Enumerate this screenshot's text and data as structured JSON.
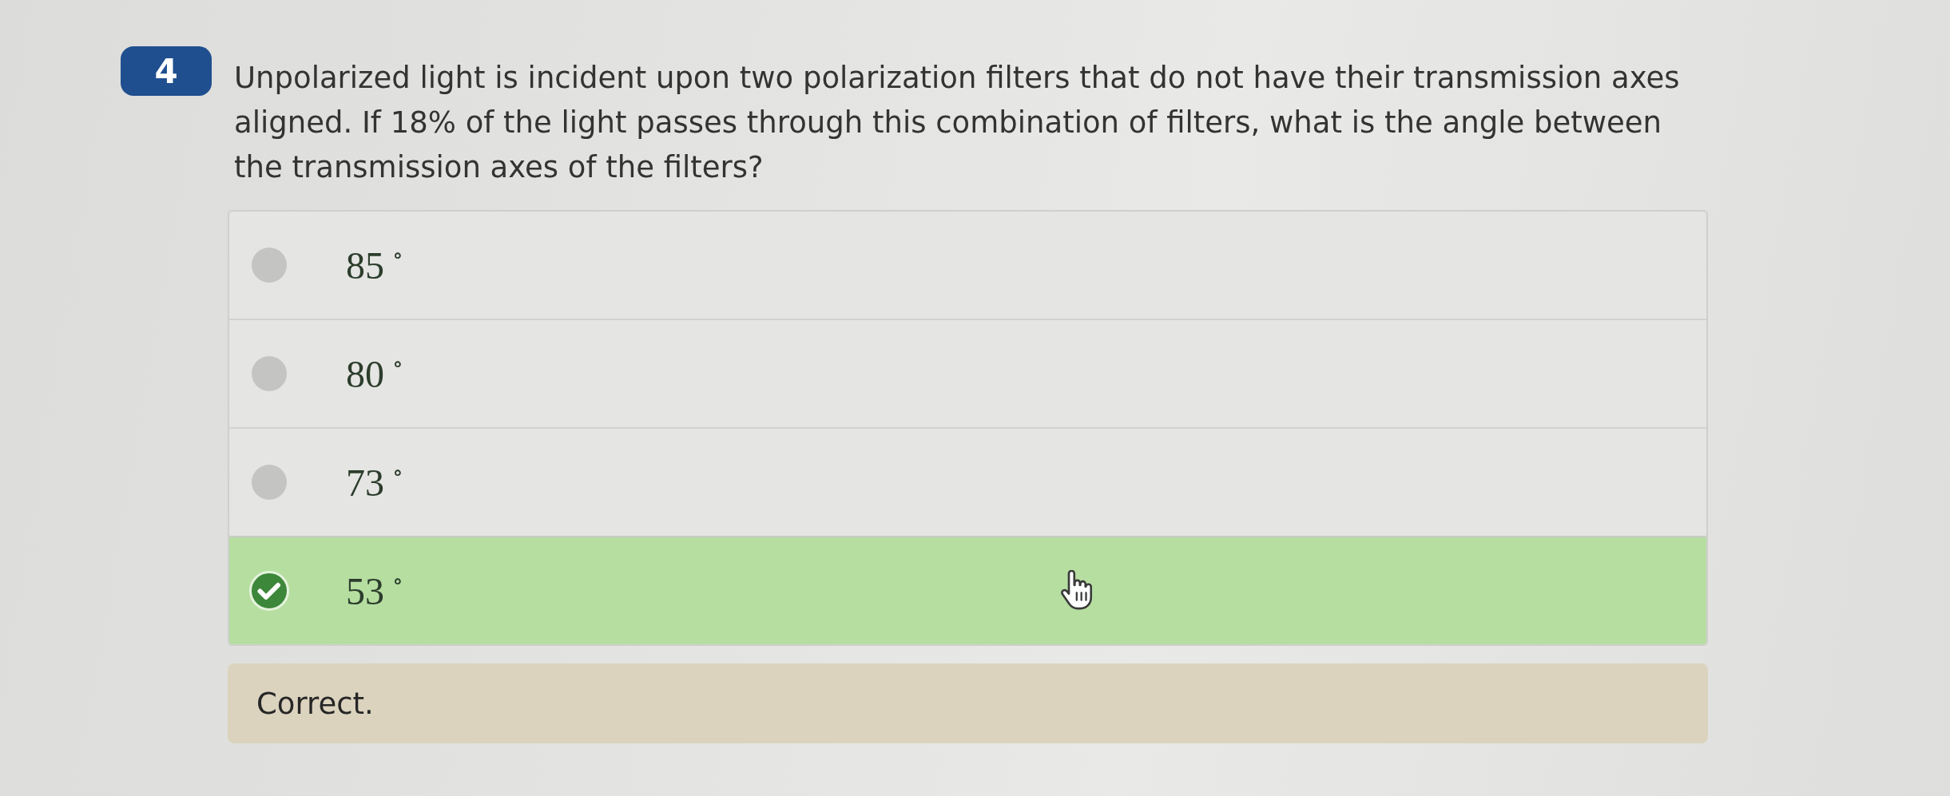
{
  "question": {
    "number": "4",
    "text": "Unpolarized light is incident upon two polarization filters that do not have their transmission axes aligned. If 18% of the light passes through this combination of filters, what is the angle between the transmission axes of the filters?"
  },
  "options": [
    {
      "label": "85$^{∘}$",
      "selected": false
    },
    {
      "label": "80$^{∘}$",
      "selected": false
    },
    {
      "label": "73$^{∘}$",
      "selected": false
    },
    {
      "label": "53$^{∘}$",
      "selected": true
    }
  ],
  "feedback": {
    "text": "Correct."
  }
}
